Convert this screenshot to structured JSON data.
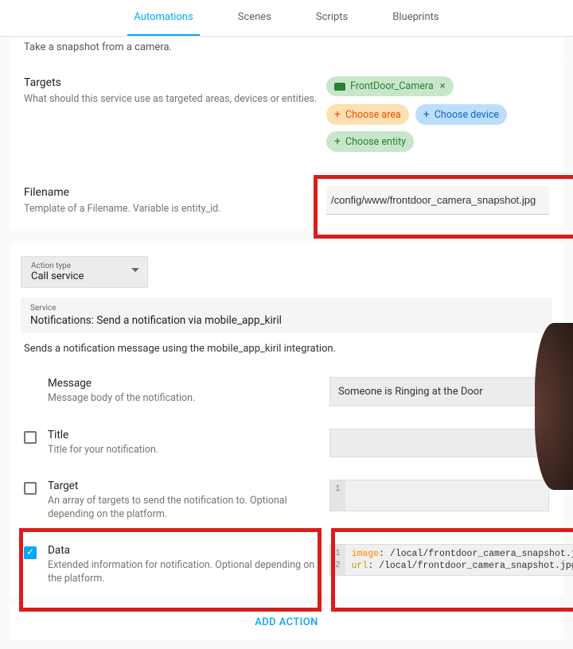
{
  "tabs": {
    "automations": "Automations",
    "scenes": "Scenes",
    "scripts": "Scripts",
    "blueprints": "Blueprints"
  },
  "snapshot_desc": "Take a snapshot from a camera.",
  "targets": {
    "label": "Targets",
    "desc": "What should this service use as targeted areas, devices or entities.",
    "camera_chip": "FrontDoor_Camera",
    "choose_area": "Choose area",
    "choose_device": "Choose device",
    "choose_entity": "Choose entity"
  },
  "filename": {
    "label": "Filename",
    "desc": "Template of a Filename. Variable is entity_id.",
    "value": "/config/www/frontdoor_camera_snapshot.jpg"
  },
  "action": {
    "type_label": "Action type",
    "type_value": "Call service",
    "service_label": "Service",
    "service_value": "Notifications: Send a notification via mobile_app_kiril",
    "desc": "Sends a notification message using the mobile_app_kiril integration."
  },
  "options": {
    "message": {
      "title": "Message",
      "desc": "Message body of the notification.",
      "value": "Someone is Ringing at the Door"
    },
    "title": {
      "title": "Title",
      "desc": "Title for your notification."
    },
    "target": {
      "title": "Target",
      "desc": "An array of targets to send the notification to. Optional depending on the platform.",
      "line1": "1"
    },
    "data": {
      "title": "Data",
      "desc": "Extended information for notification. Optional depending on the platform.",
      "gutter": "1\n2",
      "code_key1": "image",
      "code_val1": ": /local/frontdoor_camera_snapshot.jpg",
      "code_key2": "url",
      "code_val2": ": /local/frontdoor_camera_snapshot.jpg"
    }
  },
  "add_action": "ADD ACTION"
}
